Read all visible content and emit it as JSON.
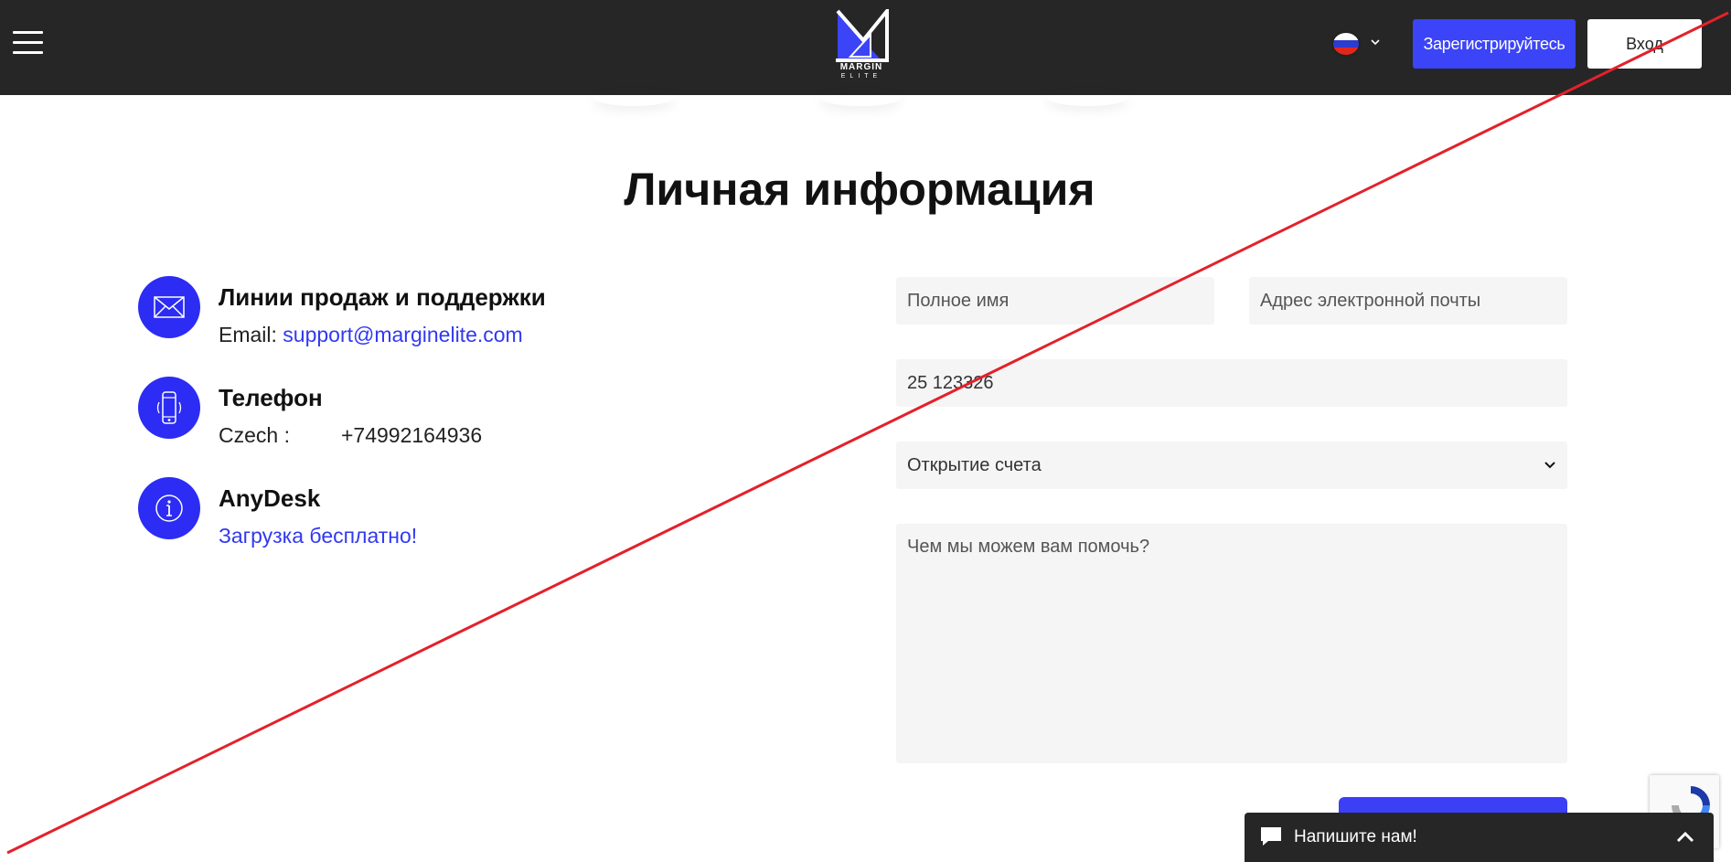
{
  "header": {
    "logo_text": "MARGIN",
    "logo_subtext": "ELITE",
    "register_label": "Зарегистрируйтесь",
    "login_label": "Вход",
    "language_flag": "russia-flag-icon"
  },
  "page_title": "Личная информация",
  "contacts": [
    {
      "icon": "envelope-icon",
      "title": "Линии продаж и поддержки",
      "prefix": "Email: ",
      "link": "support@marginelite.com"
    },
    {
      "icon": "mobile-phone-icon",
      "title": "Телефон",
      "country": "Czech :",
      "number": "+74992164936"
    },
    {
      "icon": "info-icon",
      "title": "AnyDesk",
      "link": "Загрузка бесплатно!"
    }
  ],
  "form": {
    "fullname_placeholder": "Полное имя",
    "email_placeholder": "Адрес электронной почты",
    "phone_value": "25 123326",
    "topic_selected": "Открытие счета",
    "message_placeholder": "Чем мы можем вам помочь?"
  },
  "chat": {
    "label": "Напишите нам!"
  },
  "colors": {
    "header_bg": "#262626",
    "accent": "#3b44f6",
    "icon_circle": "#2c2cf4",
    "link": "#3139f0",
    "overlay_line": "#e3212b"
  }
}
